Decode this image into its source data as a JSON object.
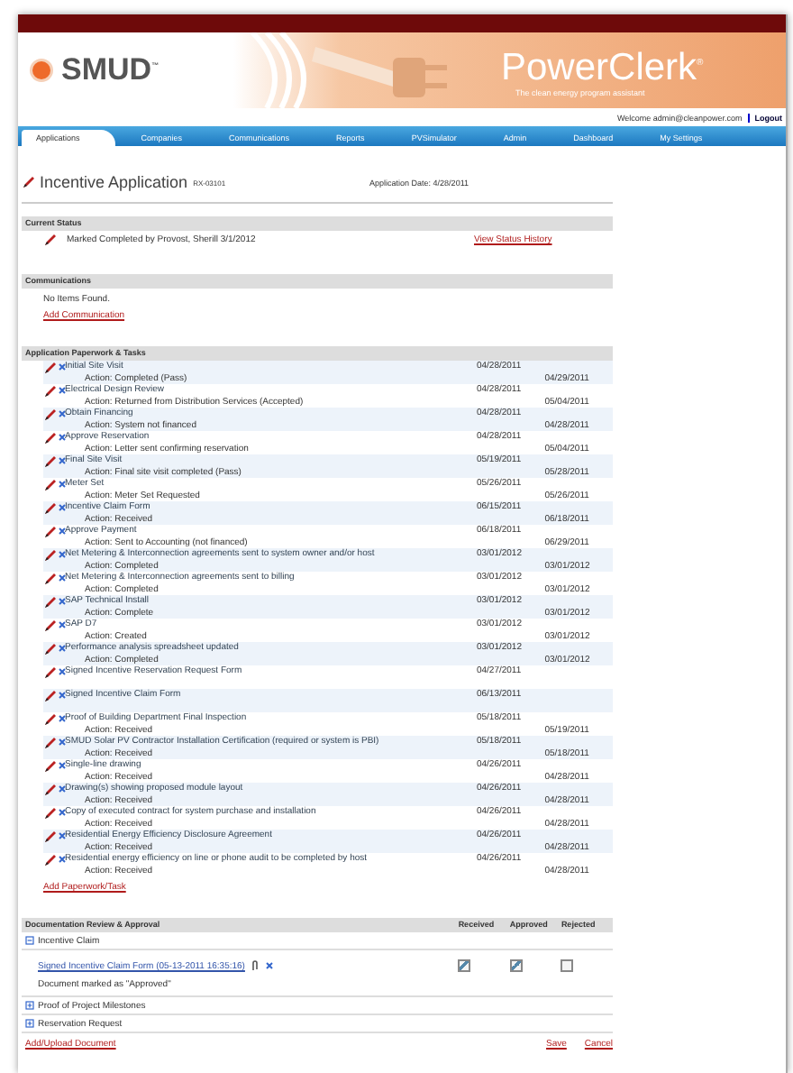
{
  "header": {
    "logo": "SMUD$^{™}$",
    "product": "PowerClerk$^{®}$",
    "tagline": "The clean energy program assistant",
    "welcome": "Welcome admin@cleanpower.com",
    "logout": "Logout"
  },
  "tabs": [
    {
      "label": "Applications",
      "selected": true
    },
    {
      "label": "Companies",
      "selected": false
    },
    {
      "label": "Communications",
      "selected": false
    },
    {
      "label": "Reports",
      "selected": false
    },
    {
      "label": "PVSimulator",
      "selected": false
    },
    {
      "label": "Admin",
      "selected": false
    },
    {
      "label": "Dashboard",
      "selected": false
    },
    {
      "label": "My Settings",
      "selected": false
    }
  ],
  "page": {
    "title": "Incentive Application",
    "app_id": "RX-03101",
    "app_date": "Application Date: 4/28/2011"
  },
  "current_status": {
    "heading": "Current Status",
    "text": "Marked Completed by Provost, Sherill  3/1/2012",
    "link": "View Status History"
  },
  "communications": {
    "heading": "Communications",
    "empty": "No Items Found.",
    "link": "Add Communication"
  },
  "tasks": {
    "heading": "Application Paperwork & Tasks",
    "link": "Add Paperwork/Task",
    "rows": [
      {
        "name": "Initial Site Visit",
        "action": "Action: Completed (Pass)",
        "date_1": "04/28/2011",
        "date_2": "04/29/2011"
      },
      {
        "name": "Electrical Design Review",
        "action": "Action: Returned from Distribution Services (Accepted)",
        "date_1": "04/28/2011",
        "date_2": "05/04/2011"
      },
      {
        "name": "Obtain Financing",
        "action": "Action: System not financed",
        "date_1": "04/28/2011",
        "date_2": "04/28/2011"
      },
      {
        "name": "Approve Reservation",
        "action": "Action: Letter sent confirming reservation",
        "date_1": "04/28/2011",
        "date_2": "05/04/2011"
      },
      {
        "name": "Final Site Visit",
        "action": "Action: Final site visit completed (Pass)",
        "date_1": "05/19/2011",
        "date_2": "05/28/2011"
      },
      {
        "name": "Meter Set",
        "action": "Action: Meter Set Requested",
        "date_1": "05/26/2011",
        "date_2": "05/26/2011"
      },
      {
        "name": "Incentive Claim Form",
        "action": "Action: Received",
        "date_1": "06/15/2011",
        "date_2": "06/18/2011"
      },
      {
        "name": "Approve Payment",
        "action": "Action: Sent to Accounting (not financed)",
        "date_1": "06/18/2011",
        "date_2": "06/29/2011"
      },
      {
        "name": "Net Metering & Interconnection agreements sent to system owner and/or host",
        "action": "Action: Completed",
        "date_1": "03/01/2012",
        "date_2": "03/01/2012"
      },
      {
        "name": "Net Metering & Interconnection agreements sent to billing",
        "action": "Action: Completed",
        "date_1": "03/01/2012",
        "date_2": "03/01/2012"
      },
      {
        "name": "SAP Technical Install",
        "action": "Action: Complete",
        "date_1": "03/01/2012",
        "date_2": "03/01/2012"
      },
      {
        "name": "SAP D7",
        "action": "Action: Created",
        "date_1": "03/01/2012",
        "date_2": "03/01/2012"
      },
      {
        "name": "Performance analysis spreadsheet updated",
        "action": "Action: Completed",
        "date_1": "03/01/2012",
        "date_2": "03/01/2012"
      },
      {
        "name": "Signed Incentive Reservation Request Form",
        "date_1": "04/27/2011"
      },
      {
        "name": "Signed Incentive Claim Form",
        "date_1": "06/13/2011"
      },
      {
        "name": "Proof of Building Department Final Inspection",
        "action": "Action: Received",
        "date_1": "05/18/2011",
        "date_2": "05/19/2011"
      },
      {
        "name": "SMUD Solar PV Contractor Installation Certification (required or system is PBI)",
        "action": "Action: Received",
        "date_1": "05/18/2011",
        "date_2": "05/18/2011"
      },
      {
        "name": "Single-line drawing",
        "action": "Action: Received",
        "date_1": "04/26/2011",
        "date_2": "04/28/2011"
      },
      {
        "name": "Drawing(s) showing proposed module layout",
        "action": "Action: Received",
        "date_1": "04/26/2011",
        "date_2": "04/28/2011"
      },
      {
        "name": "Copy of executed contract for system purchase and installation",
        "action": "Action: Received",
        "date_1": "04/26/2011",
        "date_2": "04/28/2011"
      },
      {
        "name": "Residential Energy Efficiency Disclosure Agreement",
        "action": "Action: Received",
        "date_1": "04/26/2011",
        "date_2": "04/28/2011"
      },
      {
        "name": "Residential energy efficiency on line or phone audit to be completed by host",
        "action": "Action: Received",
        "date_1": "04/26/2011",
        "date_2": "04/28/2011"
      }
    ]
  },
  "documents": {
    "heading": "Documentation Review & Approval",
    "columns": [
      "Received",
      "Approved",
      "Rejected"
    ],
    "link": "Add/Upload Document",
    "save": "Save",
    "cancel": "Cancel",
    "groups": [
      {
        "label": "Incentive Claim",
        "expanded": true,
        "items": [
          {
            "link": "Signed Incentive Claim Form (05-13-2011 16:35:16)",
            "note": "Document marked as \"Approved\"",
            "received": true,
            "approved": true,
            "rejected": false
          }
        ]
      },
      {
        "label": "Proof of Project Milestones",
        "expanded": false
      },
      {
        "label": "Reservation Request",
        "expanded": false
      }
    ]
  }
}
